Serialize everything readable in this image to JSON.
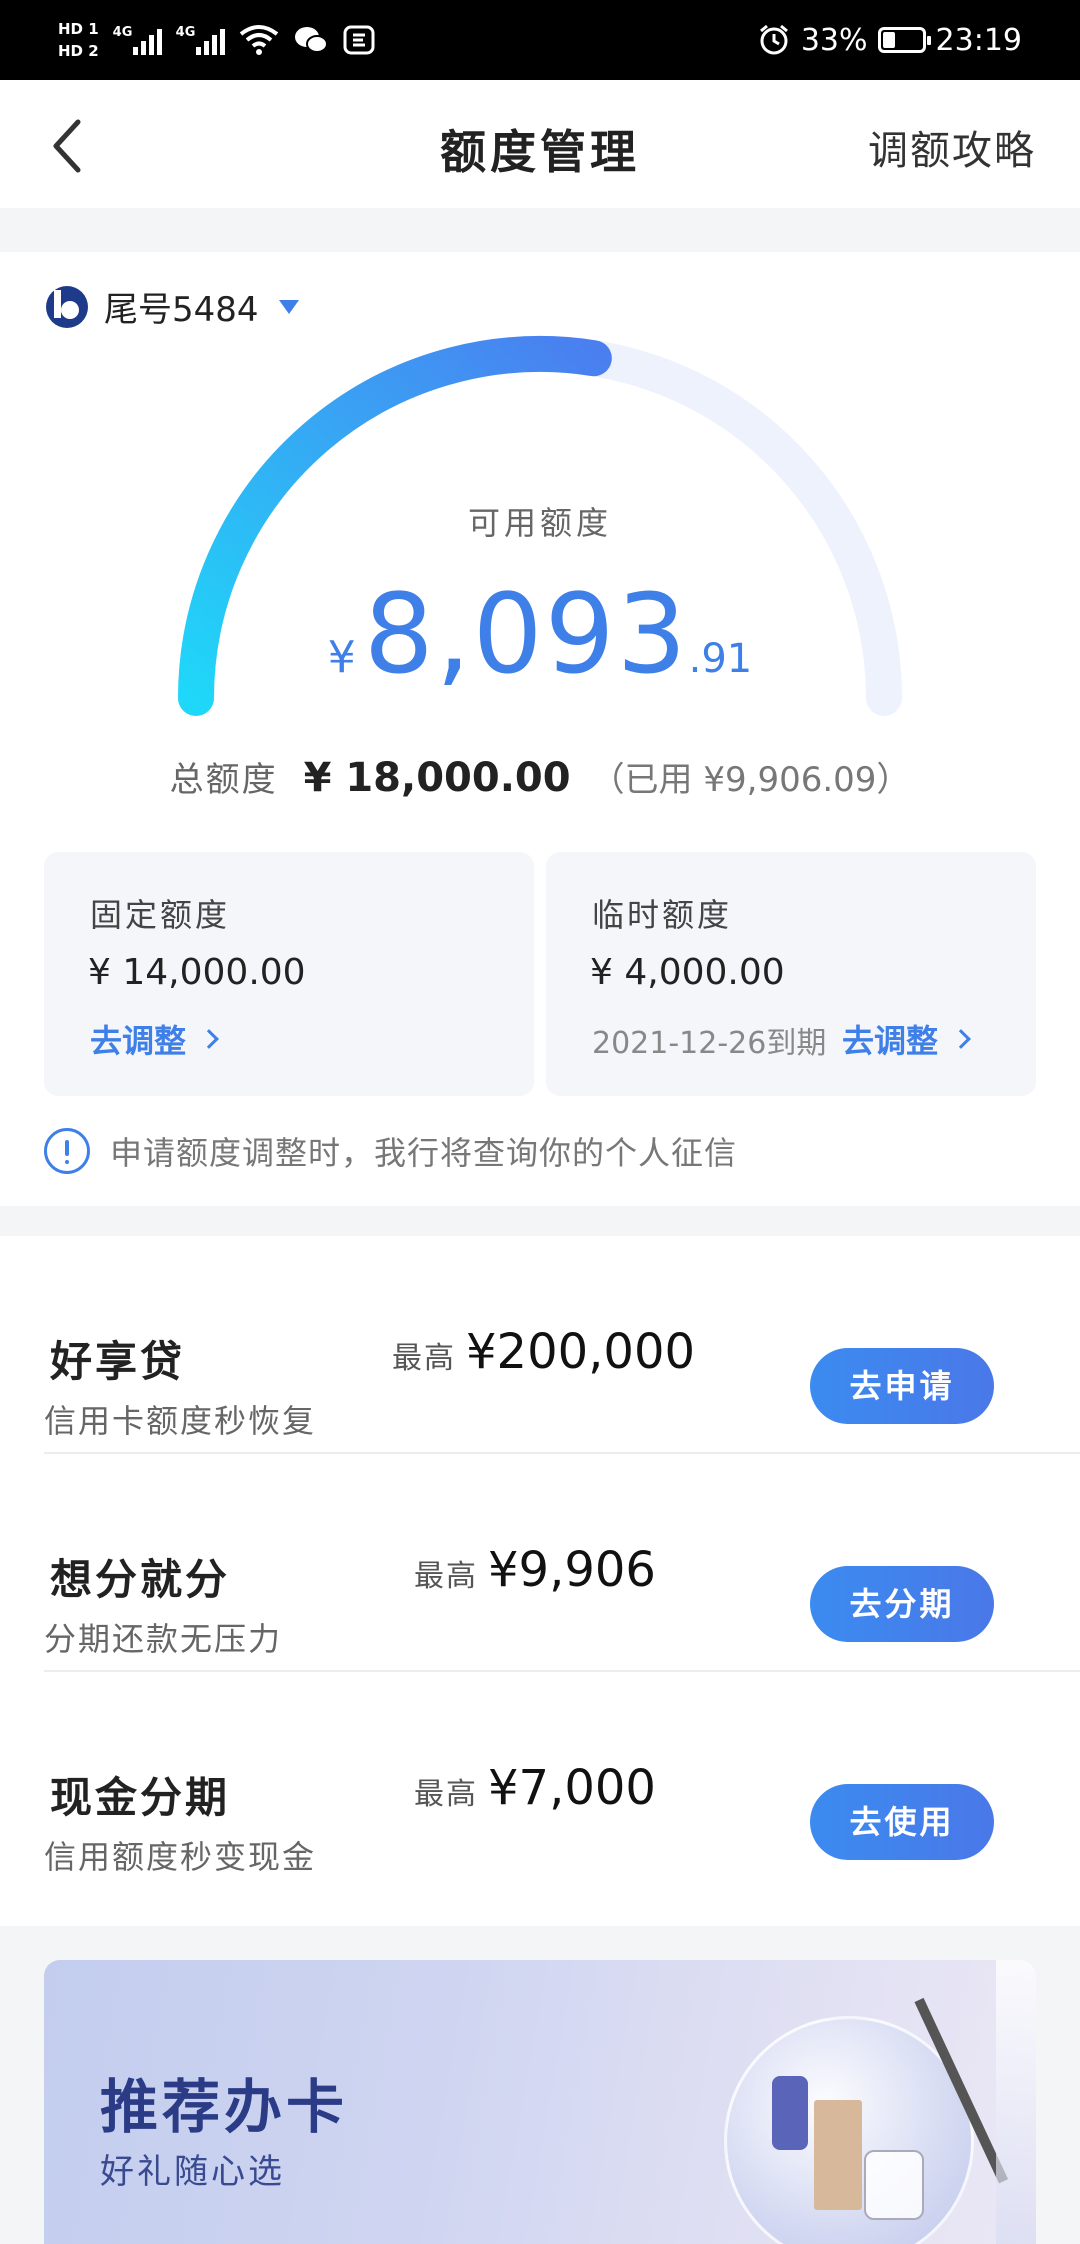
{
  "statusbar": {
    "hd1": "HD 1",
    "hd2": "HD 2",
    "net1": "4G",
    "net2": "4G",
    "battery_pct": "33%",
    "time": "23:19",
    "icons": [
      "signal-icon",
      "wifi-icon",
      "wechat-icon",
      "app-icon",
      "alarm-icon",
      "battery-icon"
    ]
  },
  "header": {
    "title": "额度管理",
    "right_link": "调额攻略"
  },
  "card": {
    "label": "尾号5484"
  },
  "quota": {
    "available_label": "可用额度",
    "currency": "¥",
    "available_int": "8,093",
    "available_dec": ".91",
    "used_fraction": 0.55,
    "total_label": "总额度",
    "total_value": "¥ 18,000.00",
    "used_text": "（已用 ¥9,906.09）"
  },
  "fixed": {
    "label": "固定额度",
    "value": "¥ 14,000.00",
    "action": "去调整"
  },
  "temp": {
    "label": "临时额度",
    "value": "¥ 4,000.00",
    "expiry": "2021-12-26到期",
    "action": "去调整"
  },
  "notice": "申请额度调整时，我行将查询你的个人征信",
  "products": [
    {
      "title": "好享贷",
      "subtitle": "信用卡额度秒恢复",
      "max_label": "最高",
      "max_value": "¥200,000",
      "button": "去申请"
    },
    {
      "title": "想分就分",
      "subtitle": "分期还款无压力",
      "max_label": "最高",
      "max_value": "¥9,906",
      "button": "去分期"
    },
    {
      "title": "现金分期",
      "subtitle": "信用额度秒变现金",
      "max_label": "最高",
      "max_value": "¥7,000",
      "button": "去使用"
    }
  ],
  "banner": {
    "title": "推荐办卡",
    "subtitle": "好礼随心选"
  },
  "colors": {
    "accent": "#3f7fe8",
    "gauge_start": "#1fd7f8",
    "gauge_end": "#4a7ff0",
    "gauge_track": "#eef2fd"
  }
}
